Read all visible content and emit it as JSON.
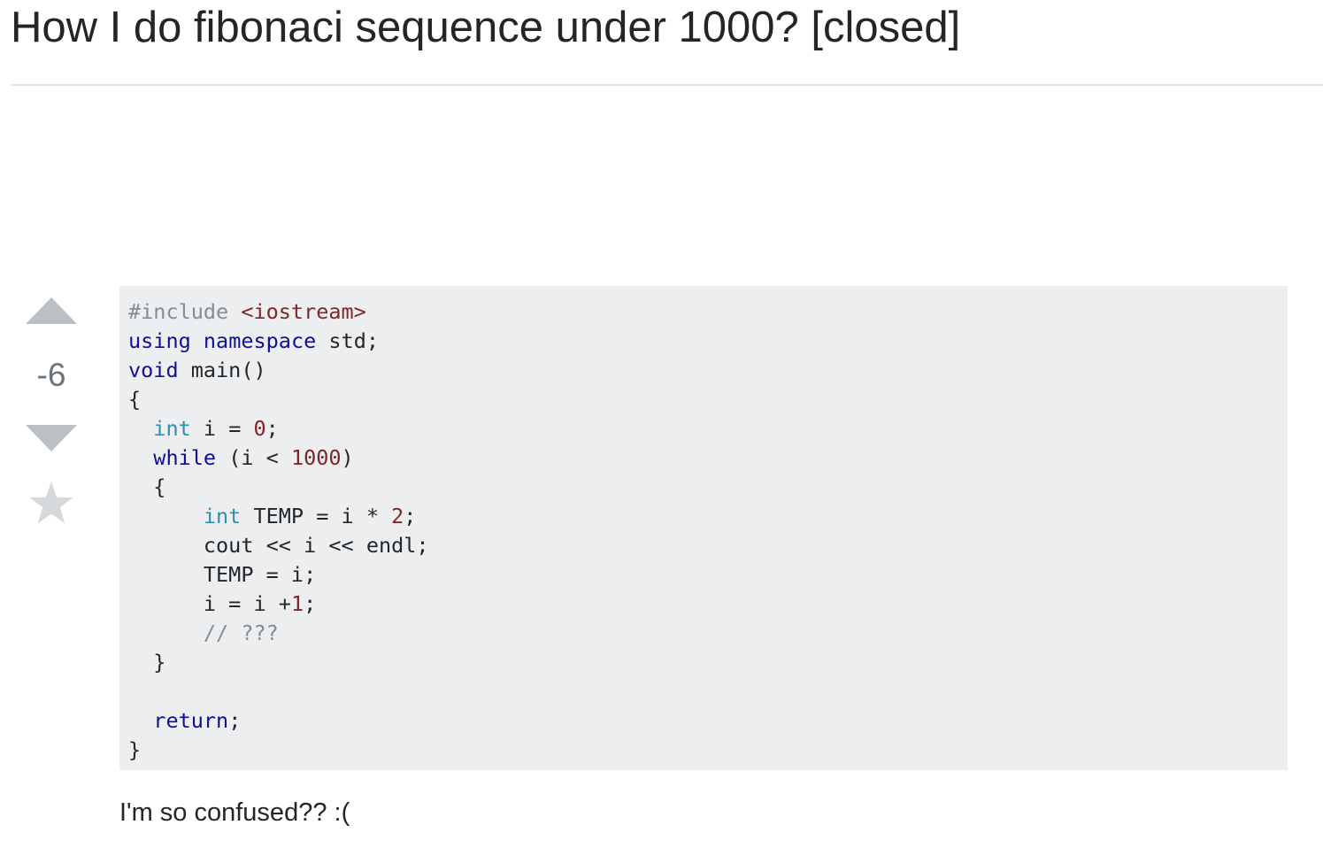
{
  "question": {
    "title": "How I do fibonaci sequence under 1000? [closed]",
    "score": "-6",
    "body_text": "I'm so confused?? :(",
    "icons": {
      "upvote": "arrow-up-icon",
      "downvote": "arrow-down-icon",
      "bookmark": "star-icon"
    }
  },
  "colors": {
    "code_background": "#eceef0",
    "vote_arrow": "#bbc0c4",
    "keyword": "#101094",
    "type": "#2b91af",
    "literal": "#7d2727",
    "comment": "#858c93"
  },
  "code": {
    "lines": [
      [
        {
          "t": "pre",
          "v": "#include "
        },
        {
          "t": "str",
          "v": "<iostream>"
        }
      ],
      [
        {
          "t": "kw",
          "v": "using"
        },
        {
          "t": "plain",
          "v": " "
        },
        {
          "t": "kw",
          "v": "namespace"
        },
        {
          "t": "plain",
          "v": " std;"
        }
      ],
      [
        {
          "t": "kw",
          "v": "void"
        },
        {
          "t": "plain",
          "v": " main()"
        }
      ],
      [
        {
          "t": "plain",
          "v": "{"
        }
      ],
      [
        {
          "t": "plain",
          "v": "  "
        },
        {
          "t": "type",
          "v": "int"
        },
        {
          "t": "plain",
          "v": " i = "
        },
        {
          "t": "num",
          "v": "0"
        },
        {
          "t": "plain",
          "v": ";"
        }
      ],
      [
        {
          "t": "plain",
          "v": "  "
        },
        {
          "t": "kw",
          "v": "while"
        },
        {
          "t": "plain",
          "v": " (i < "
        },
        {
          "t": "num",
          "v": "1000"
        },
        {
          "t": "plain",
          "v": ")"
        }
      ],
      [
        {
          "t": "plain",
          "v": "  {"
        }
      ],
      [
        {
          "t": "plain",
          "v": "      "
        },
        {
          "t": "type",
          "v": "int"
        },
        {
          "t": "plain",
          "v": " TEMP = i * "
        },
        {
          "t": "num",
          "v": "2"
        },
        {
          "t": "plain",
          "v": ";"
        }
      ],
      [
        {
          "t": "plain",
          "v": "      cout << i << endl;"
        }
      ],
      [
        {
          "t": "plain",
          "v": "      TEMP = i;"
        }
      ],
      [
        {
          "t": "plain",
          "v": "      i = i +"
        },
        {
          "t": "num",
          "v": "1"
        },
        {
          "t": "plain",
          "v": ";"
        }
      ],
      [
        {
          "t": "plain",
          "v": "      "
        },
        {
          "t": "com",
          "v": "// ???"
        }
      ],
      [
        {
          "t": "plain",
          "v": "  }"
        }
      ],
      [
        {
          "t": "plain",
          "v": ""
        }
      ],
      [
        {
          "t": "plain",
          "v": "  "
        },
        {
          "t": "kw",
          "v": "return"
        },
        {
          "t": "plain",
          "v": ";"
        }
      ],
      [
        {
          "t": "plain",
          "v": "}"
        }
      ]
    ]
  }
}
